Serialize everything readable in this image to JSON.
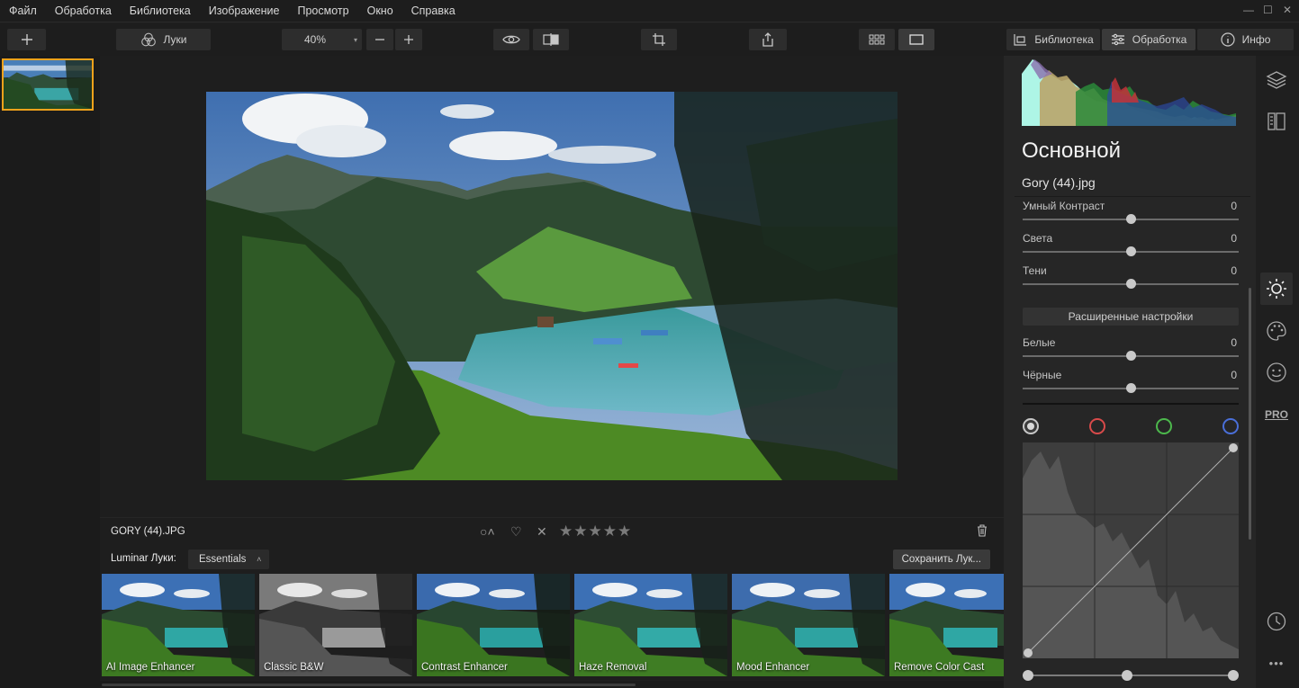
{
  "menu": {
    "items": [
      "Файл",
      "Обработка",
      "Библиотека",
      "Изображение",
      "Просмотр",
      "Окно",
      "Справка"
    ]
  },
  "toolbar": {
    "add_icon": "plus-icon",
    "looks_label": "Луки",
    "zoom_value": "40%",
    "library_tab": "Библиотека",
    "edit_tab": "Обработка",
    "info_tab": "Инфо",
    "active_tab": "Обработка"
  },
  "image": {
    "filename": "GORY (44).JPG",
    "rating_stars": 0
  },
  "looks_bar": {
    "label": "Luminar Луки:",
    "collection": "Essentials",
    "save_button": "Сохранить Лук..."
  },
  "looks": [
    {
      "label": "AI Image Enhancer"
    },
    {
      "label": "Classic B&W"
    },
    {
      "label": "Contrast Enhancer"
    },
    {
      "label": "Haze Removal"
    },
    {
      "label": "Mood Enhancer"
    },
    {
      "label": "Remove Color Cast"
    }
  ],
  "panel": {
    "title": "Основной",
    "file": "Gory (44).jpg",
    "sliders": [
      {
        "label": "Умный Контраст",
        "value": "0"
      },
      {
        "label": "Света",
        "value": "0"
      },
      {
        "label": "Тени",
        "value": "0"
      }
    ],
    "advanced_button": "Расширенные настройки",
    "advanced_sliders": [
      {
        "label": "Белые",
        "value": "0"
      },
      {
        "label": "Чёрные",
        "value": "0"
      }
    ],
    "channels": [
      {
        "name": "luminosity",
        "color": "#c8c8c8"
      },
      {
        "name": "red",
        "color": "#d84a4a"
      },
      {
        "name": "green",
        "color": "#4cb84c"
      },
      {
        "name": "blue",
        "color": "#4a6fd8"
      }
    ]
  },
  "rail": {
    "pro_label": "PRO",
    "more_label": "•••"
  },
  "colors": {
    "accent": "#f0a21b"
  }
}
